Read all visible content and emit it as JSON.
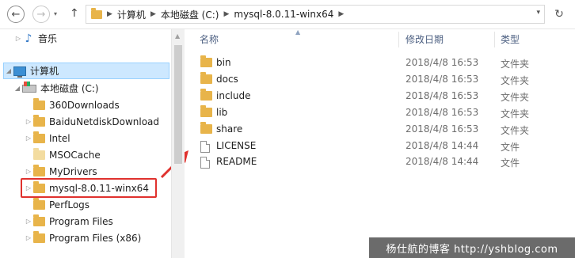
{
  "address_bar": {
    "crumbs": [
      "计算机",
      "本地磁盘 (C:)",
      "mysql-8.0.11-winx64"
    ]
  },
  "navigation": {
    "back_icon": "back-arrow-icon",
    "forward_icon": "forward-arrow-icon",
    "up_icon": "up-arrow-icon",
    "refresh_icon": "refresh-icon"
  },
  "tree": {
    "music": "音乐",
    "computer": "计算机",
    "drive": "本地磁盘 (C:)",
    "folders": [
      "360Downloads",
      "BaiduNetdiskDownload",
      "Intel",
      "MSOCache",
      "MyDrivers",
      "mysql-8.0.11-winx64",
      "PerfLogs",
      "Program Files",
      "Program Files (x86)"
    ]
  },
  "columns": {
    "name": "名称",
    "modified": "修改日期",
    "type": "类型"
  },
  "files": [
    {
      "name": "bin",
      "date": "2018/4/8 16:53",
      "type": "文件夹",
      "kind": "folder"
    },
    {
      "name": "docs",
      "date": "2018/4/8 16:53",
      "type": "文件夹",
      "kind": "folder"
    },
    {
      "name": "include",
      "date": "2018/4/8 16:53",
      "type": "文件夹",
      "kind": "folder"
    },
    {
      "name": "lib",
      "date": "2018/4/8 16:53",
      "type": "文件夹",
      "kind": "folder"
    },
    {
      "name": "share",
      "date": "2018/4/8 16:53",
      "type": "文件夹",
      "kind": "folder"
    },
    {
      "name": "LICENSE",
      "date": "2018/4/8 14:44",
      "type": "文件",
      "kind": "file"
    },
    {
      "name": "README",
      "date": "2018/4/8 14:44",
      "type": "文件",
      "kind": "file"
    }
  ],
  "watermark": "杨仕航的博客 http://yshblog.com",
  "colors": {
    "folder": "#e8b44a",
    "selection": "#cde8ff",
    "highlight_box": "#e0322e"
  }
}
